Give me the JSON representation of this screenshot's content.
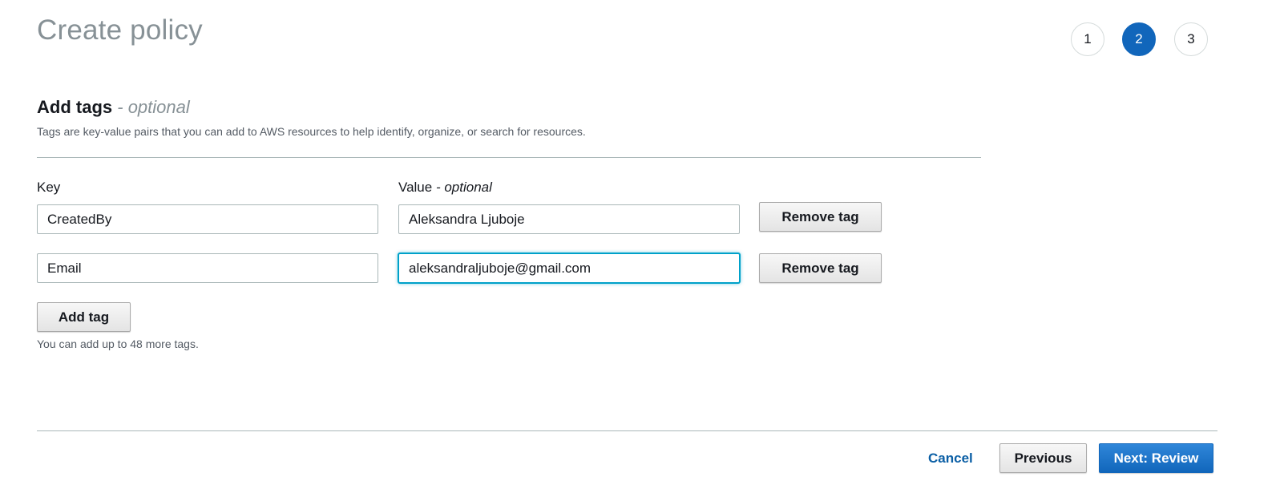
{
  "page": {
    "title": "Create policy"
  },
  "steps": [
    {
      "label": "1",
      "active": false
    },
    {
      "label": "2",
      "active": true
    },
    {
      "label": "3",
      "active": false
    }
  ],
  "section": {
    "heading": "Add tags",
    "heading_optional": "- optional",
    "description": "Tags are key-value pairs that you can add to AWS resources to help identify, organize, or search for resources."
  },
  "columns": {
    "key_label": "Key",
    "value_label": "Value",
    "value_optional": "- optional"
  },
  "tags": [
    {
      "key": "CreatedBy",
      "value": "Aleksandra Ljuboje",
      "remove_label": "Remove tag"
    },
    {
      "key": "Email",
      "value": "aleksandraljuboje@gmail.com",
      "remove_label": "Remove tag"
    }
  ],
  "add_tag_label": "Add tag",
  "hint": "You can add up to 48 more tags.",
  "footer": {
    "cancel_label": "Cancel",
    "previous_label": "Previous",
    "next_label": "Next: Review"
  },
  "colors": {
    "accent": "#1166bb",
    "focus": "#00a1c9",
    "link": "#0b5fa5",
    "title_gray": "#879196"
  }
}
